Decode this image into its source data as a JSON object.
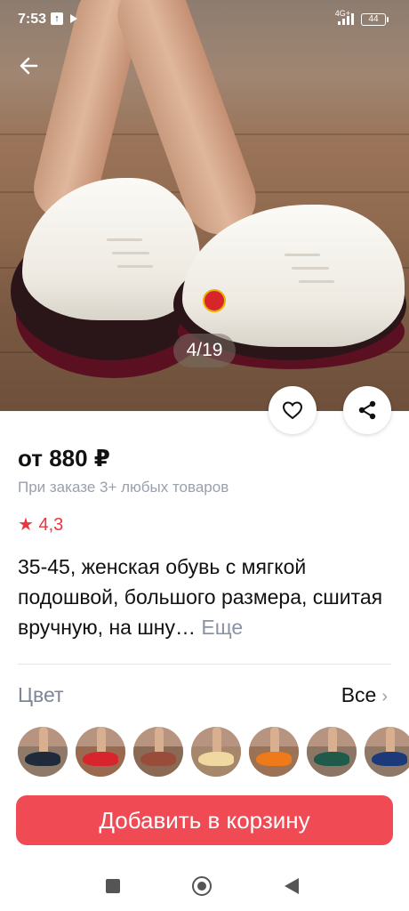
{
  "status_bar": {
    "time": "7:53",
    "network": "4G+",
    "battery": "44"
  },
  "gallery": {
    "pager": "4/19",
    "current": 4,
    "total": 19
  },
  "product": {
    "price": "от 880 ₽",
    "price_note": "При заказе 3+ любых товаров",
    "rating_star": "★",
    "rating": "4,3",
    "title": "35-45, женская обувь с мягкой подошвой, большого размера, сшитая вручную, на шну…",
    "more_label": "Еще"
  },
  "color_section": {
    "label": "Цвет",
    "all_label": "Все",
    "swatches": [
      {
        "name": "black",
        "shoe_color": "#1f2a3a",
        "floor": "#8f7a6a"
      },
      {
        "name": "red",
        "shoe_color": "#d8242c",
        "floor": "#9a6a50"
      },
      {
        "name": "brown",
        "shoe_color": "#9a4c3a",
        "floor": "#8a6a55"
      },
      {
        "name": "beige",
        "shoe_color": "#f0d9a0",
        "floor": "#a7876c"
      },
      {
        "name": "orange",
        "shoe_color": "#ee7a1a",
        "floor": "#9b7255"
      },
      {
        "name": "green",
        "shoe_color": "#1f5a4a",
        "floor": "#8c7565"
      },
      {
        "name": "blue",
        "shoe_color": "#1c3a7a",
        "floor": "#8e7868"
      }
    ]
  },
  "actions": {
    "add_to_cart": "Добавить в корзину"
  },
  "colors": {
    "accent": "#f04a55",
    "rating": "#e8373f",
    "muted": "#9aa0ac"
  }
}
